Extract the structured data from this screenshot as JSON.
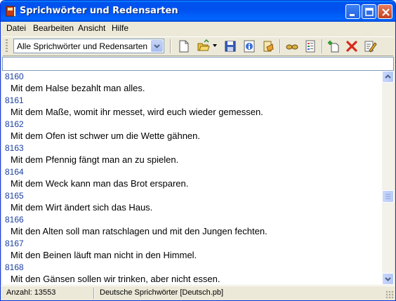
{
  "window": {
    "title": "Sprichwörter und Redensarten"
  },
  "menu": [
    "Datei",
    "Bearbeiten",
    "Ansicht",
    "Hilfe"
  ],
  "toolbar": {
    "filter_value": "Alle Sprichwörter und Redensarten",
    "icons": [
      "new-document-icon",
      "open-folder-icon",
      "save-icon",
      "info-icon",
      "print-icon",
      "glasses-icon",
      "list-icon",
      "add-icon",
      "delete-icon",
      "edit-icon"
    ]
  },
  "entries": [
    {
      "num": "8160",
      "text": "Mit dem Halse bezahlt man alles."
    },
    {
      "num": "8161",
      "text": "Mit dem Maße, womit ihr messet, wird euch wieder gemessen."
    },
    {
      "num": "8162",
      "text": "Mit dem Ofen ist schwer um die Wette gähnen."
    },
    {
      "num": "8163",
      "text": "Mit dem Pfennig fängt man an zu spielen."
    },
    {
      "num": "8164",
      "text": "Mit dem Weck kann man das Brot ersparen."
    },
    {
      "num": "8165",
      "text": "Mit dem Wirt ändert sich das Haus."
    },
    {
      "num": "8166",
      "text": "Mit den Alten soll man ratschlagen und mit den Jungen fechten."
    },
    {
      "num": "8167",
      "text": "Mit den Beinen läuft man nicht in den Himmel."
    },
    {
      "num": "8168",
      "text": "Mit den Gänsen sollen wir trinken, aber nicht essen."
    }
  ],
  "status": {
    "count": "Anzahl: 13553",
    "file": "Deutsche Sprichwörter [Deutsch.pb]"
  },
  "colors": {
    "titlebar": "#0050ee",
    "entry_number": "#1a3fa3",
    "chrome": "#ece9d8"
  }
}
